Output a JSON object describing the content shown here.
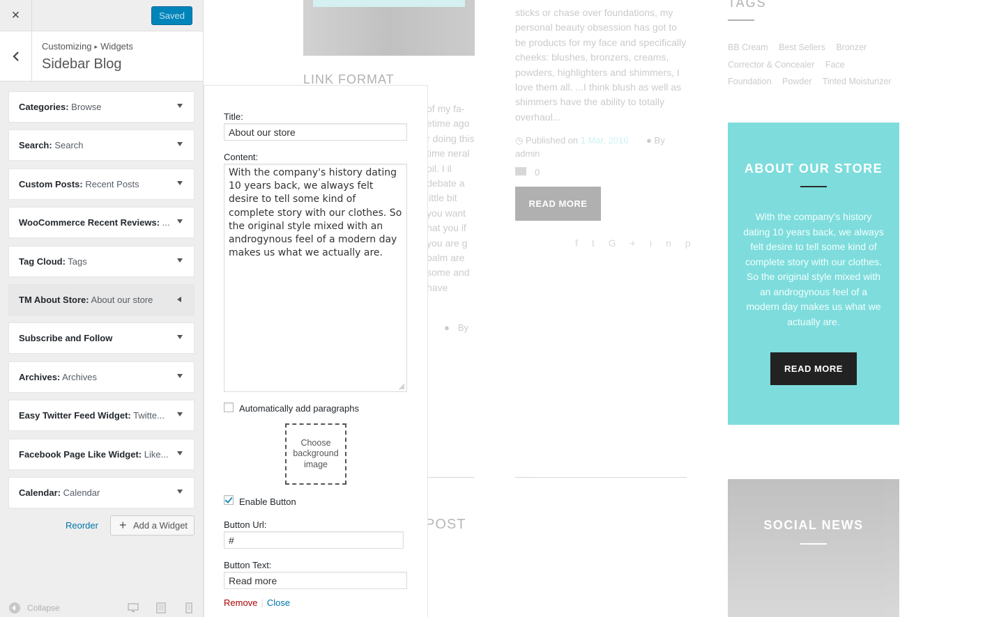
{
  "header": {
    "close_label": "×",
    "saved_label": "Saved"
  },
  "title_panel": {
    "crumb_1": "Customizing",
    "crumb_sep": "▸",
    "crumb_2": "Widgets",
    "section_title": "Sidebar Blog"
  },
  "widgets": [
    {
      "name": "Categories:",
      "value": " Browse"
    },
    {
      "name": "Search:",
      "value": " Search"
    },
    {
      "name": "Custom Posts:",
      "value": " Recent Posts"
    },
    {
      "name": "WooCommerce Recent Reviews:",
      "value": " ..."
    },
    {
      "name": "Tag Cloud:",
      "value": " Tags"
    },
    {
      "name": "TM About Store:",
      "value": " About our store"
    },
    {
      "name": "Subscribe and Follow",
      "value": ""
    },
    {
      "name": "Archives:",
      "value": " Archives"
    },
    {
      "name": "Easy Twitter Feed Widget:",
      "value": " Twitte..."
    },
    {
      "name": "Facebook Page Like Widget:",
      "value": " Like..."
    },
    {
      "name": "Calendar:",
      "value": " Calendar"
    }
  ],
  "actions": {
    "reorder": "Reorder",
    "add_widget": "Add a Widget"
  },
  "footer": {
    "collapse": "Collapse"
  },
  "form": {
    "title_label": "Title:",
    "title_value": "About our store",
    "content_label": "Content:",
    "content_value": "With the company's history dating 10 years back, we always felt desire to tell some kind of complete story with our clothes. So the original style mixed with an androgynous feel of a modern day makes us what we actually are.",
    "auto_paragraphs_label": "Automatically add paragraphs",
    "auto_paragraphs_checked": false,
    "choose_bg": "Choose background image",
    "enable_button_label": "Enable Button",
    "enable_button_checked": true,
    "button_url_label": "Button Url:",
    "button_url_value": "#",
    "button_text_label": "Button Text:",
    "button_text_value": "Read more",
    "remove_link": "Remove",
    "link_sep": "|",
    "close_link": "Close"
  },
  "preview": {
    "link_format_heading": "LINK FORMAT",
    "post_text": "sticks or chase over foundations, my personal beauty obsession has got to be products for my face and specifically cheeks: blushes, bronzers, creams, powders, highlighters and shimmers, I love them all. ...I think blush as well as shimmers have the ability to totally overhaul...",
    "meta_published": "Published on",
    "meta_date": "1 Mar, 2016",
    "meta_by": "By",
    "meta_author": "admin",
    "comments_count": "0",
    "read_more_1": "READ MORE",
    "left_col_text": "of my fa- etime ago r doing this time neral oil. I il debate a little bit you want hat you if you are g balm are some and have",
    "left_by": "By",
    "post_heading": "POST",
    "tags_heading": "TAGS",
    "tags": [
      "BB Cream",
      "Best Sellers",
      "Bronzer",
      "Corrector & Concealer",
      "Face",
      "Foundation",
      "Powder",
      "Tinted Moisturizer"
    ],
    "about_heading": "ABOUT OUR STORE",
    "about_text": "With the company's history dating 10 years back, we always felt desire to tell some kind of complete story with our clothes. So the original style mixed with an androgynous feel of a modern day makes us what we actually are.",
    "about_button": "READ MORE",
    "social_heading": "SOCIAL NEWS"
  },
  "colors": {
    "primary_button": "#0085ba",
    "about_bg": "#7edcdc",
    "link": "#0073aa"
  }
}
